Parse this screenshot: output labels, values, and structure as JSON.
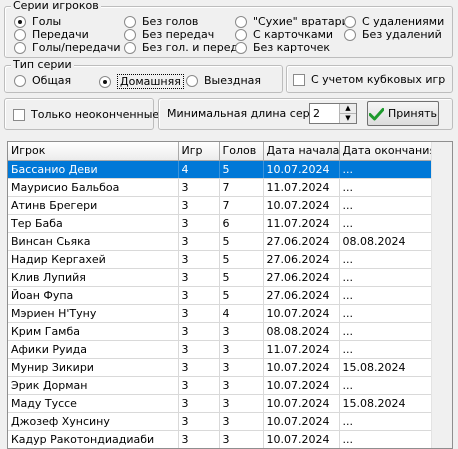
{
  "player_series": {
    "title": "Серии игроков",
    "options": [
      {
        "label": "Голы",
        "checked": true
      },
      {
        "label": "Передачи",
        "checked": false
      },
      {
        "label": "Голы/передачи",
        "checked": false
      },
      {
        "label": "Без голов",
        "checked": false
      },
      {
        "label": "Без передач",
        "checked": false
      },
      {
        "label": "Без гол. и перед.",
        "checked": false
      },
      {
        "label": "\"Сухие\" вратари",
        "checked": false
      },
      {
        "label": "С карточками",
        "checked": false
      },
      {
        "label": "Без карточек",
        "checked": false
      },
      {
        "label": "С удалениями",
        "checked": false
      },
      {
        "label": "Без удалений",
        "checked": false
      }
    ]
  },
  "series_type": {
    "title": "Тип серии",
    "options": [
      {
        "label": "Общая",
        "checked": false
      },
      {
        "label": "Домашняя",
        "checked": true
      },
      {
        "label": "Выездная",
        "checked": false
      }
    ]
  },
  "cup_games": {
    "label": "С учетом кубковых игр",
    "checked": false
  },
  "unfinished_only": {
    "label": "Только неоконченные",
    "checked": false
  },
  "min_length": {
    "label": "Минимальная длина серии",
    "value": "2"
  },
  "accept_button": {
    "label": "Принять"
  },
  "table": {
    "columns": [
      "Игрок",
      "Игр",
      "Голов",
      "Дата начала",
      "Дата окончания"
    ],
    "rows": [
      [
        "Бассанио Деви",
        "4",
        "5",
        "10.07.2024",
        "..."
      ],
      [
        "Маурисио Бальбоа",
        "3",
        "7",
        "11.07.2024",
        "..."
      ],
      [
        "Атинв Брегери",
        "3",
        "7",
        "10.07.2024",
        "..."
      ],
      [
        "Тер Баба",
        "3",
        "6",
        "11.07.2024",
        "..."
      ],
      [
        "Винсан Сьяка",
        "3",
        "5",
        "27.06.2024",
        "08.08.2024"
      ],
      [
        "Надир Кергахей",
        "3",
        "5",
        "27.06.2024",
        "..."
      ],
      [
        "Клив Лупийя",
        "3",
        "5",
        "27.06.2024",
        "..."
      ],
      [
        "Йоан Фупа",
        "3",
        "5",
        "27.06.2024",
        "..."
      ],
      [
        "Мэриен Н'Туну",
        "3",
        "4",
        "10.07.2024",
        "..."
      ],
      [
        "Крим Гамба",
        "3",
        "3",
        "08.08.2024",
        "..."
      ],
      [
        "Афики Руида",
        "3",
        "3",
        "11.07.2024",
        "..."
      ],
      [
        "Мунир Зикири",
        "3",
        "3",
        "10.07.2024",
        "15.08.2024"
      ],
      [
        "Эрик Дорман",
        "3",
        "3",
        "10.07.2024",
        "..."
      ],
      [
        "Маду Туссе",
        "3",
        "3",
        "10.07.2024",
        "15.08.2024"
      ],
      [
        "Джозеф Хунсину",
        "3",
        "3",
        "10.07.2024",
        "..."
      ],
      [
        "Кадур Ракотондиадиаби",
        "3",
        "3",
        "10.07.2024",
        "..."
      ]
    ]
  },
  "colors": {
    "selection": "#0078d7",
    "window_bg": "#f0f0f0"
  },
  "icons": {
    "accept": "checkmark-icon",
    "spin_up": "spin-up-icon",
    "spin_down": "spin-down-icon"
  }
}
